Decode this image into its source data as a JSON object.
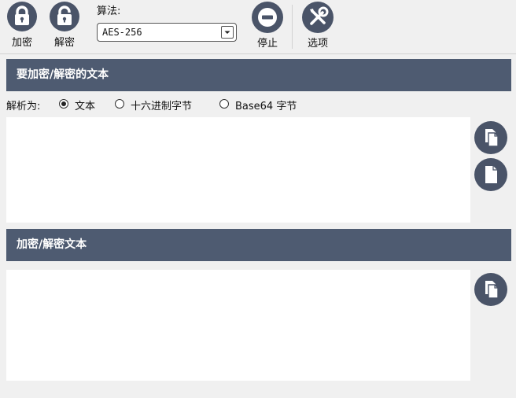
{
  "toolbar": {
    "encrypt_label": "加密",
    "decrypt_label": "解密",
    "algorithm_label": "算法:",
    "algorithm_value": "AES-256",
    "stop_label": "停止",
    "options_label": "选项"
  },
  "input_section": {
    "title": "要加密/解密的文本",
    "parse_as_label": "解析为:",
    "options": [
      "文本",
      "十六进制字节",
      "Base64 字节"
    ],
    "selected": "文本"
  },
  "output_section": {
    "title": "加密/解密文本"
  },
  "colors": {
    "header_bg": "#4e5b71",
    "icon_bg": "#4a5468",
    "window_bg": "#f0f0f0"
  },
  "icons": {
    "encrypt": "lock-icon",
    "decrypt": "unlock-icon",
    "stop": "stop-icon",
    "options": "tools-icon",
    "copy": "copy-icon",
    "paste": "paste-icon"
  }
}
